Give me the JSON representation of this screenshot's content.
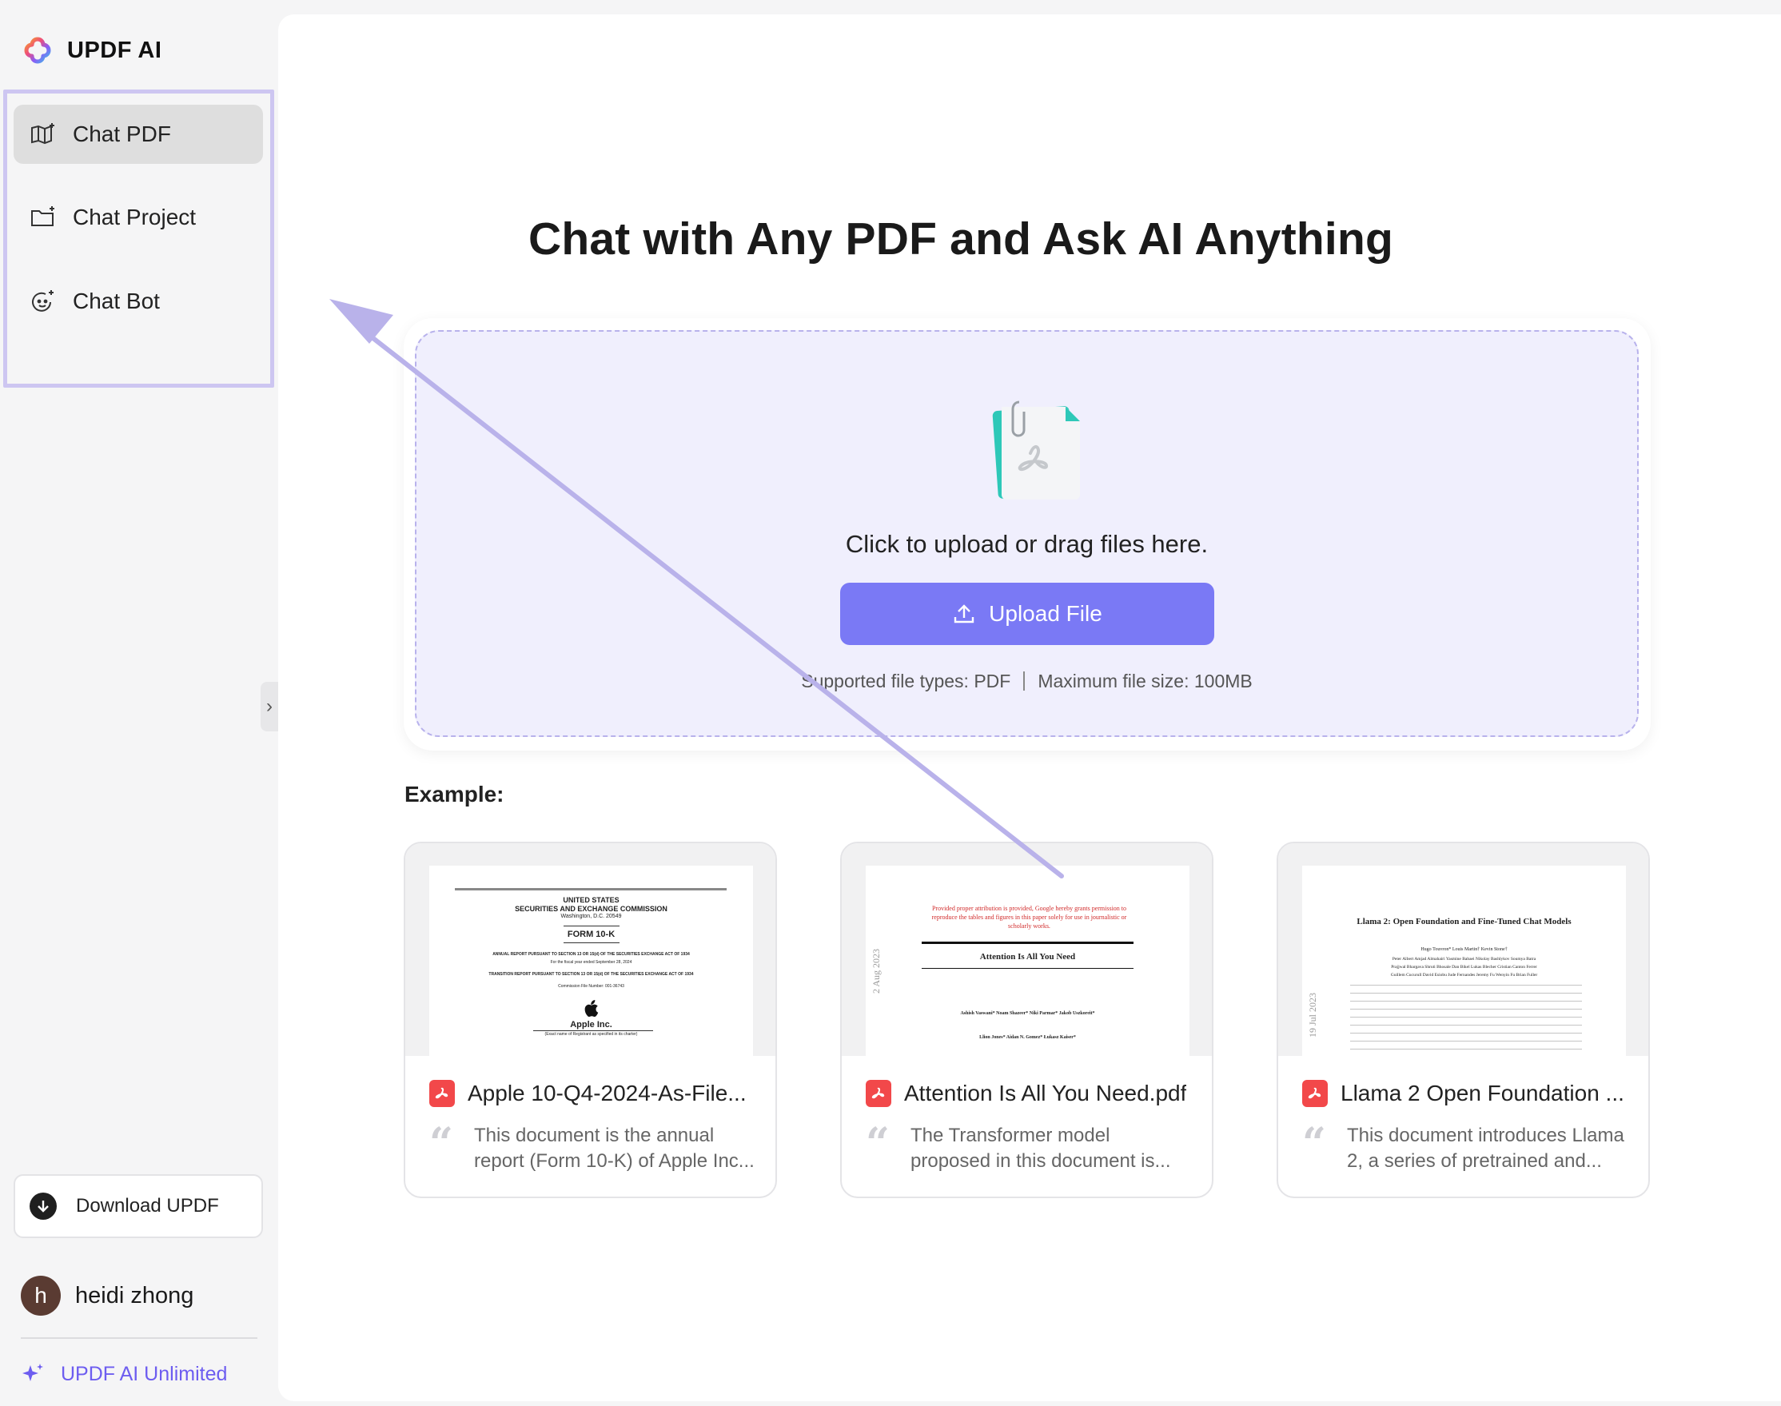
{
  "brand": {
    "name": "UPDF AI"
  },
  "sidebar": {
    "items": [
      {
        "label": "Chat PDF",
        "active": true
      },
      {
        "label": "Chat Project",
        "active": false
      },
      {
        "label": "Chat Bot",
        "active": false
      }
    ],
    "download_label": "Download UPDF",
    "user": {
      "initial": "h",
      "name": "heidi zhong"
    },
    "plan_label": "UPDF AI Unlimited"
  },
  "main": {
    "title": "Chat with Any PDF and Ask AI Anything",
    "upload": {
      "hint": "Click to upload or drag files here.",
      "button_label": "Upload File",
      "supported": "Supported file types: PDF",
      "max_size": "Maximum file size: 100MB"
    },
    "example_label": "Example:",
    "examples": [
      {
        "title": "Apple 10-Q4-2024-As-File...",
        "description": "This document is the annual report (Form 10-K) of Apple Inc...",
        "thumb": {
          "l1": "UNITED STATES",
          "l2": "SECURITIES AND EXCHANGE COMMISSION",
          "l3": "Washington, D.C. 20549",
          "l4": "FORM 10-K",
          "l5": "ANNUAL REPORT PURSUANT TO SECTION 13 OR 15(d) OF THE SECURITIES EXCHANGE ACT OF 1934",
          "l6": "For the fiscal year ended September 28, 2024",
          "l7": "TRANSITION REPORT PURSUANT TO SECTION 13 OR 15(d) OF THE SECURITIES EXCHANGE ACT OF 1934",
          "l8": "Commission File Number: 001-36743",
          "company": "Apple Inc.",
          "l9": "(Exact name of Registrant as specified in its charter)"
        }
      },
      {
        "title": "Attention Is All You Need.pdf",
        "description": "The Transformer model proposed in this document is...",
        "thumb": {
          "notice": "Provided proper attribution is provided, Google hereby grants permission to reproduce the tables and figures in this paper solely for use in journalistic or scholarly works.",
          "heading": "Attention Is All You Need",
          "authors1": "Ashish Vaswani*   Noam Shazeer*   Niki Parmar*   Jakob Uszkoreit*",
          "authors2": "Llion Jones*   Aidan N. Gomez*   Łukasz Kaiser*",
          "side": "2 Aug 2023"
        }
      },
      {
        "title": "Llama 2 Open Foundation ...",
        "description": "This document introduces Llama 2, a series of pretrained and...",
        "thumb": {
          "heading": "Llama 2: Open Foundation and Fine-Tuned Chat Models",
          "authors1": "Hugo Touvron*   Louis Martin†   Kevin Stone†",
          "authors2": "Peter Albert  Amjad Almahairi  Yasmine Babaei  Nikolay Bashlykov  Soumya Batra",
          "authors3": "Prajjwal Bhargava  Shruti Bhosale  Dan Bikel  Lukas Blecher  Cristian Canton Ferrer",
          "authors4": "Guillem Cucurull  David Esiobu  Jude Fernandes  Jeremy Fu  Wenyin Fu  Brian Fuller",
          "side": "19 Jul 2023"
        }
      }
    ]
  },
  "colors": {
    "accent": "#7a79f5",
    "brand_purple": "#6d5df0",
    "highlight_border": "#cdc6f1",
    "upload_bg": "#f0effd",
    "pdf_red": "#f2484a"
  },
  "icons": {
    "nav": [
      "book-sparkle-icon",
      "folder-sparkle-icon",
      "bot-face-icon"
    ],
    "upload": "upload-arrow-icon",
    "download": "download-arrow-icon",
    "plan": "sparkle-icon"
  }
}
